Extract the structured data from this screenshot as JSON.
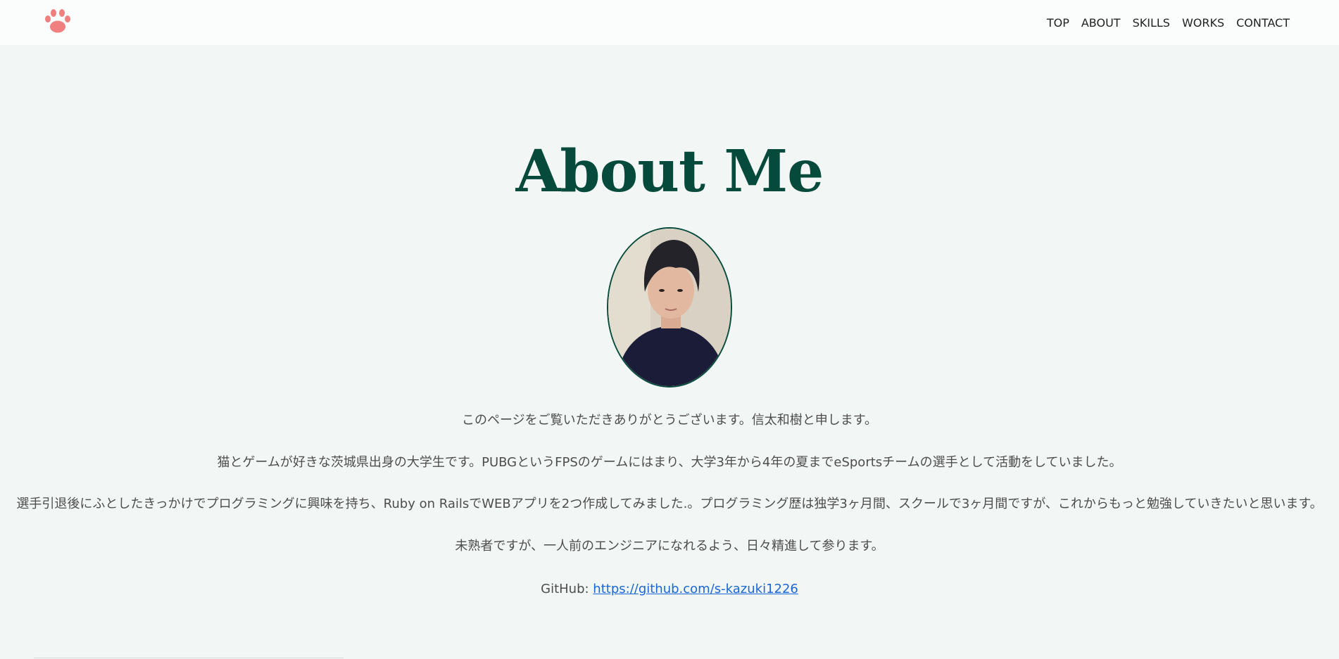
{
  "header": {
    "logo": "paw-icon",
    "nav": [
      {
        "label": "TOP"
      },
      {
        "label": "ABOUT"
      },
      {
        "label": "SKILLS"
      },
      {
        "label": "WORKS"
      },
      {
        "label": "CONTACT"
      }
    ]
  },
  "about": {
    "title": "About Me",
    "paragraphs": [
      "このページをご覧いただきありがとうございます。信太和樹と申します。",
      "猫とゲームが好きな茨城県出身の大学生です。PUBGというFPSのゲームにはまり、大学3年から4年の夏までeSportsチームの選手として活動をしていました。",
      "選手引退後にふとしたきっかけでプログラミングに興味を持ち、Ruby on RailsでWEBアプリを2つ作成してみました.。プログラミング歴は独学3ヶ月間、スクールで3ヶ月間ですが、これからもっと勉強していきたいと思います。",
      "未熟者ですが、一人前のエンジニアになれるよう、日々精進して参ります。"
    ],
    "github_label": "GitHub: ",
    "github_link": "https://github.com/s-kazuki1226"
  },
  "colors": {
    "accent": "#064a3c",
    "logo": "#f08080",
    "background": "#f2f6f4",
    "link": "#1a66d9"
  }
}
